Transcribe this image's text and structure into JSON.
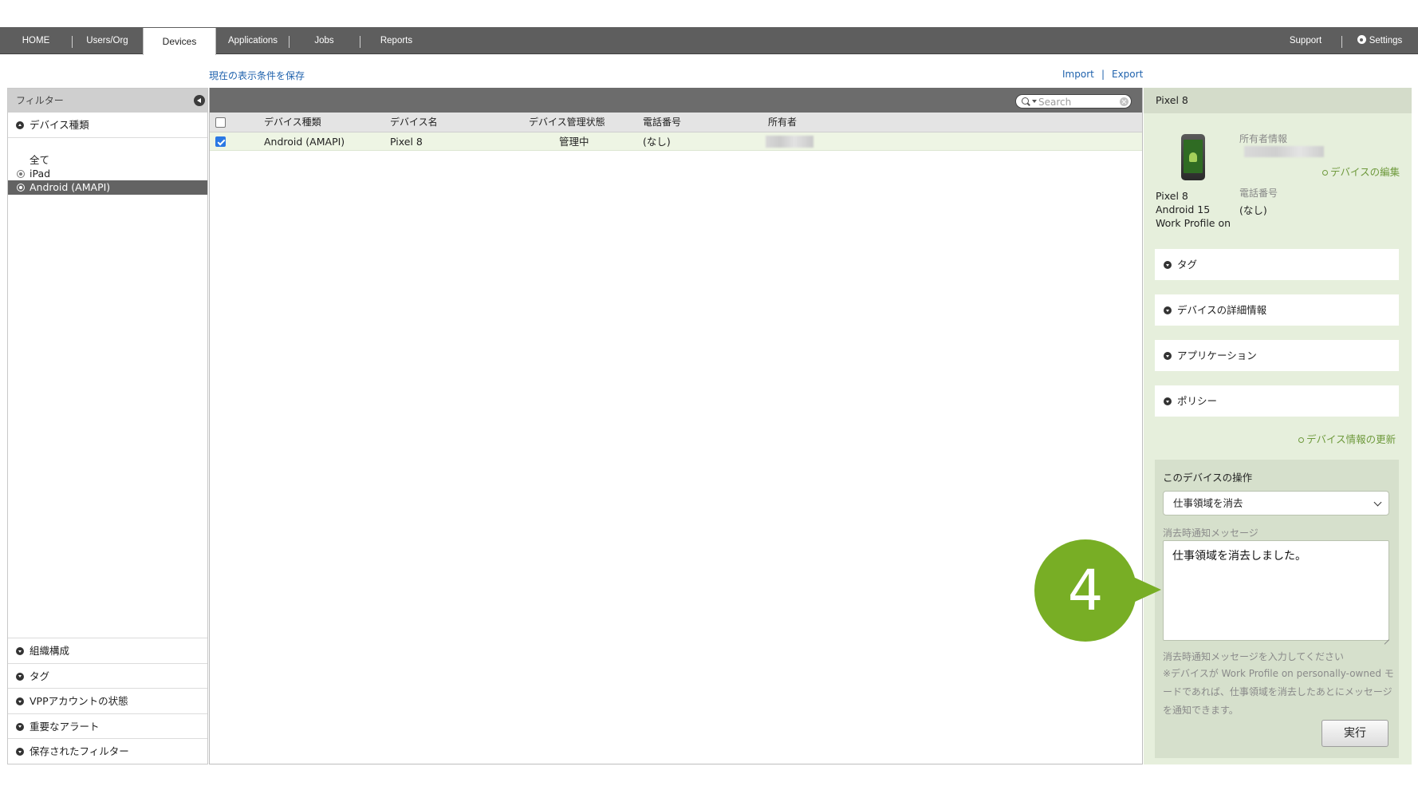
{
  "nav": {
    "items": [
      "HOME",
      "Users/Org",
      "Devices",
      "Applications",
      "Jobs",
      "Reports"
    ],
    "active": "Devices",
    "support": "Support",
    "settings": "Settings"
  },
  "links": {
    "save_view": "現在の表示条件を保存",
    "import": "Import",
    "separator": "|",
    "export": "Export"
  },
  "filter": {
    "title": "フィルター",
    "device_type_section": "デバイス種類",
    "types": [
      "全て",
      "iPad",
      "Android (AMAPI)"
    ],
    "selected_type": "Android (AMAPI)",
    "sections": [
      "組織構成",
      "タグ",
      "VPPアカウントの状態",
      "重要なアラート",
      "保存されたフィルター"
    ]
  },
  "search": {
    "placeholder": "Search",
    "value": ""
  },
  "table": {
    "columns": [
      "デバイス種類",
      "デバイス名",
      "デバイス管理状態",
      "電話番号",
      "所有者"
    ],
    "rows": [
      {
        "type": "Android (AMAPI)",
        "name": "Pixel 8",
        "status": "管理中",
        "phone": "(なし)",
        "checked": true
      }
    ]
  },
  "detail": {
    "title": "Pixel 8",
    "device_name": "Pixel 8",
    "os": "Android 15",
    "mode": "Work Profile on",
    "owner_label": "所有者情報",
    "edit_link": "デバイスの編集",
    "phone_label": "電話番号",
    "phone_value": "(なし)",
    "sections": [
      "タグ",
      "デバイスの詳細情報",
      "アプリケーション",
      "ポリシー"
    ],
    "refresh_link": "デバイス情報の更新"
  },
  "operation": {
    "title": "このデバイスの操作",
    "selected": "仕事領域を消去",
    "message_label": "消去時通知メッセージ",
    "message_value": "仕事領域を消去しました。",
    "hint1": "消去時通知メッセージを入力してください",
    "hint2": "※デバイスが Work Profile on personally-owned モードであれば、仕事領域を消去したあとにメッセージを通知できます。",
    "run_label": "実行"
  },
  "step_number": "4",
  "colors": {
    "nav_bg": "#5e5e5e",
    "link": "#1f62ad",
    "detail_bg": "#e6efdc",
    "selected_row": "#eef5e4",
    "step_bubble": "#78ae25",
    "green_link": "#6f9a3d"
  }
}
